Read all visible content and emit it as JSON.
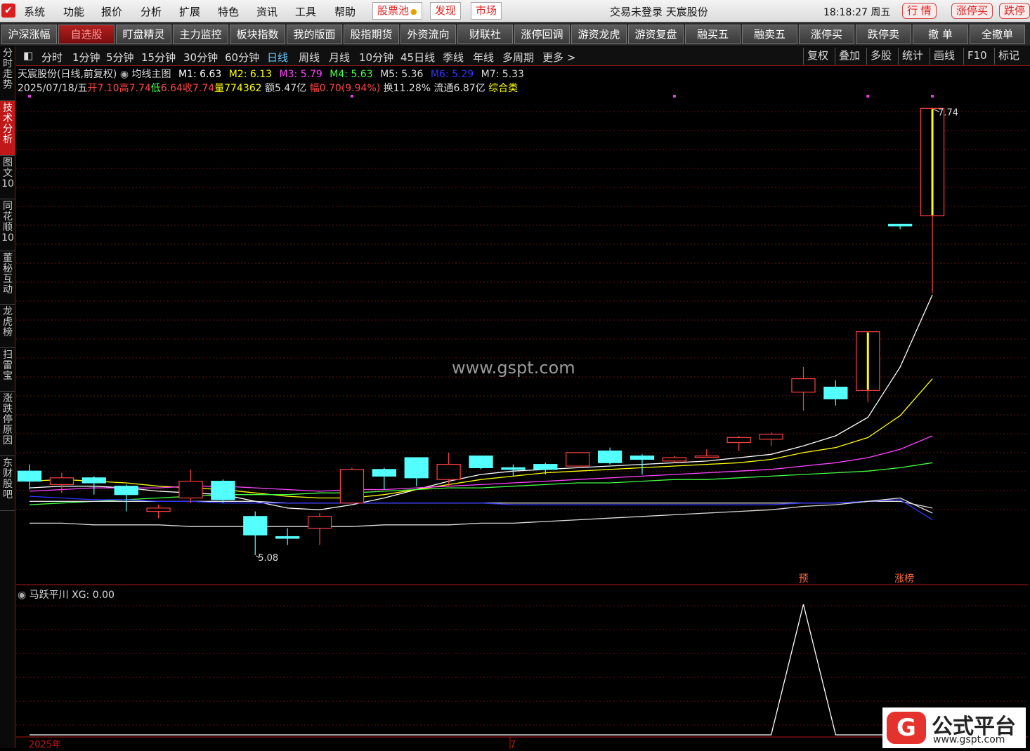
{
  "menubar": {
    "logo": "✔",
    "items": [
      "系统",
      "功能",
      "报价",
      "分析",
      "扩展",
      "特色",
      "资讯",
      "工具",
      "帮助"
    ],
    "red_items": [
      "股票池",
      "发现",
      "市场"
    ],
    "center_title": "交易未登录  天宸股份",
    "clock": "18:18:27 周五",
    "right_buttons": [
      "行  情",
      "涨停买",
      "跌停"
    ]
  },
  "toolbar": {
    "buttons": [
      "沪深涨幅",
      "自选股",
      "盯盘精灵",
      "主力监控",
      "板块指数",
      "我的版面",
      "股指期货",
      "外资流向",
      "财联社",
      "涨停回调",
      "游资龙虎",
      "游资复盘",
      "融买五",
      "融卖五",
      "涨停买",
      "跌停卖",
      "撤  单",
      "全撤单"
    ],
    "active": "自选股"
  },
  "side_tabs": [
    "分时走势",
    "技术分析",
    "图文10",
    "同花顺10",
    "董秘互动",
    "龙虎榜",
    "扫雷宝",
    "涨跌停原因",
    "东财股吧"
  ],
  "side_tab_active": "技术分析",
  "periods": [
    "分时",
    "1分钟",
    "5分钟",
    "15分钟",
    "30分钟",
    "60分钟",
    "日线",
    "周线",
    "月线",
    "10分钟",
    "45日线",
    "季线",
    "年线",
    "多周期",
    "更多 >"
  ],
  "period_active": "日线",
  "right_tools": [
    "复权",
    "叠加",
    "多股",
    "统计",
    "画线",
    "F10",
    "标记"
  ],
  "info": {
    "stock": "天宸股份(日线,前复权)",
    "indicator": "均线主图",
    "ma": [
      {
        "label": "M1: 6.63",
        "color": "#ffffff"
      },
      {
        "label": "M2: 6.13",
        "color": "#ffff00"
      },
      {
        "label": "M3: 5.79",
        "color": "#ff44ff"
      },
      {
        "label": "M4: 5.63",
        "color": "#44ff44"
      },
      {
        "label": "M5: 5.36",
        "color": "#dddddd"
      },
      {
        "label": "M6: 5.29",
        "color": "#3333ff"
      },
      {
        "label": "M7: 5.33",
        "color": "#dddddd"
      }
    ],
    "date": "2025/07/18/五",
    "open_label": "开",
    "open": "7.10",
    "high_label": "高",
    "high": "7.74",
    "low_label": "低",
    "low": "6.64",
    "close_label": "收",
    "close": "7.74",
    "vol_label": "量",
    "vol": "774362",
    "amount": "额5.47亿",
    "change_label": "幅",
    "change": "0.70(9.94%)",
    "turnover": "换11.28%",
    "float": "流通6.87亿",
    "category": "综合类"
  },
  "labels": {
    "high_mark": "7.74",
    "low_mark": "5.08",
    "pre_tag": "预",
    "limit_tag": "涨榜",
    "year": "2025年",
    "month": "7"
  },
  "indicator_panel": {
    "title": "马跃平川 XG: 0.00"
  },
  "watermark": "www.gspt.com",
  "brand": {
    "glyph": "G",
    "name": "公式平台",
    "url": "www.gspt.com"
  },
  "colors": {
    "up": "#ff4040",
    "down": "#54ffff",
    "limit": "#ffff00",
    "accent": "#c01818"
  },
  "chart_data": {
    "type": "candlestick",
    "candles": [
      {
        "o": 5.58,
        "h": 5.62,
        "l": 5.47,
        "c": 5.52
      },
      {
        "o": 5.5,
        "h": 5.57,
        "l": 5.45,
        "c": 5.54
      },
      {
        "o": 5.54,
        "h": 5.55,
        "l": 5.44,
        "c": 5.51
      },
      {
        "o": 5.49,
        "h": 5.5,
        "l": 5.34,
        "c": 5.44
      },
      {
        "o": 5.34,
        "h": 5.38,
        "l": 5.3,
        "c": 5.36
      },
      {
        "o": 5.42,
        "h": 5.59,
        "l": 5.39,
        "c": 5.52
      },
      {
        "o": 5.52,
        "h": 5.53,
        "l": 5.39,
        "c": 5.41
      },
      {
        "o": 5.31,
        "h": 5.34,
        "l": 5.08,
        "c": 5.2
      },
      {
        "o": 5.19,
        "h": 5.24,
        "l": 5.14,
        "c": 5.18
      },
      {
        "o": 5.24,
        "h": 5.33,
        "l": 5.14,
        "c": 5.31
      },
      {
        "o": 5.39,
        "h": 5.6,
        "l": 5.39,
        "c": 5.59
      },
      {
        "o": 5.59,
        "h": 5.6,
        "l": 5.47,
        "c": 5.55
      },
      {
        "o": 5.66,
        "h": 5.66,
        "l": 5.49,
        "c": 5.54
      },
      {
        "o": 5.53,
        "h": 5.69,
        "l": 5.49,
        "c": 5.62
      },
      {
        "o": 5.67,
        "h": 5.67,
        "l": 5.59,
        "c": 5.6
      },
      {
        "o": 5.6,
        "h": 5.62,
        "l": 5.55,
        "c": 5.59
      },
      {
        "o": 5.62,
        "h": 5.63,
        "l": 5.56,
        "c": 5.59
      },
      {
        "o": 5.61,
        "h": 5.69,
        "l": 5.61,
        "c": 5.69
      },
      {
        "o": 5.7,
        "h": 5.72,
        "l": 5.62,
        "c": 5.63
      },
      {
        "o": 5.67,
        "h": 5.68,
        "l": 5.56,
        "c": 5.65
      },
      {
        "o": 5.64,
        "h": 5.67,
        "l": 5.63,
        "c": 5.66
      },
      {
        "o": 5.67,
        "h": 5.71,
        "l": 5.66,
        "c": 5.67
      },
      {
        "o": 5.75,
        "h": 5.79,
        "l": 5.7,
        "c": 5.78
      },
      {
        "o": 5.77,
        "h": 5.81,
        "l": 5.73,
        "c": 5.8
      },
      {
        "o": 6.05,
        "h": 6.2,
        "l": 5.94,
        "c": 6.13
      },
      {
        "o": 6.08,
        "h": 6.12,
        "l": 5.97,
        "c": 6.01
      },
      {
        "o": 6.06,
        "h": 6.41,
        "l": 5.99,
        "c": 6.41
      },
      {
        "o": 7.05,
        "h": 7.05,
        "l": 7.02,
        "c": 7.04
      },
      {
        "o": 7.1,
        "h": 7.74,
        "l": 6.64,
        "c": 7.74
      }
    ],
    "ma_lines": [
      {
        "name": "M1",
        "color": "#ffffff",
        "values": [
          5.48,
          5.49,
          5.49,
          5.48,
          5.46,
          5.45,
          5.44,
          5.4,
          5.36,
          5.35,
          5.38,
          5.42,
          5.47,
          5.52,
          5.56,
          5.58,
          5.59,
          5.6,
          5.61,
          5.62,
          5.63,
          5.64,
          5.66,
          5.68,
          5.73,
          5.79,
          5.9,
          6.2,
          6.63
        ]
      },
      {
        "name": "M2",
        "color": "#ffff00",
        "values": [
          5.52,
          5.53,
          5.52,
          5.51,
          5.49,
          5.48,
          5.47,
          5.45,
          5.43,
          5.42,
          5.42,
          5.44,
          5.47,
          5.5,
          5.53,
          5.55,
          5.57,
          5.58,
          5.59,
          5.6,
          5.61,
          5.62,
          5.63,
          5.65,
          5.69,
          5.72,
          5.78,
          5.91,
          6.13
        ]
      },
      {
        "name": "M3",
        "color": "#ff44ff",
        "values": [
          5.46,
          5.47,
          5.48,
          5.48,
          5.48,
          5.49,
          5.49,
          5.48,
          5.47,
          5.46,
          5.47,
          5.47,
          5.48,
          5.49,
          5.5,
          5.51,
          5.52,
          5.53,
          5.54,
          5.55,
          5.56,
          5.57,
          5.58,
          5.59,
          5.61,
          5.63,
          5.66,
          5.71,
          5.79
        ]
      },
      {
        "name": "M4",
        "color": "#44ff44",
        "values": [
          5.38,
          5.39,
          5.4,
          5.41,
          5.42,
          5.43,
          5.44,
          5.44,
          5.44,
          5.45,
          5.45,
          5.46,
          5.47,
          5.48,
          5.48,
          5.49,
          5.5,
          5.51,
          5.51,
          5.52,
          5.53,
          5.53,
          5.54,
          5.55,
          5.56,
          5.57,
          5.58,
          5.6,
          5.63
        ]
      },
      {
        "name": "M5",
        "color": "#dddddd",
        "values": [
          5.4,
          5.4,
          5.4,
          5.4,
          5.4,
          5.4,
          5.4,
          5.4,
          5.39,
          5.39,
          5.39,
          5.39,
          5.39,
          5.39,
          5.39,
          5.39,
          5.39,
          5.39,
          5.39,
          5.39,
          5.39,
          5.39,
          5.39,
          5.39,
          5.39,
          5.39,
          5.4,
          5.4,
          5.36
        ]
      },
      {
        "name": "M6",
        "color": "#3333ff",
        "values": [
          5.43,
          5.42,
          5.41,
          5.41,
          5.4,
          5.4,
          5.39,
          5.39,
          5.39,
          5.39,
          5.39,
          5.39,
          5.39,
          5.39,
          5.39,
          5.38,
          5.38,
          5.38,
          5.38,
          5.38,
          5.38,
          5.38,
          5.38,
          5.38,
          5.39,
          5.39,
          5.4,
          5.41,
          5.29
        ]
      },
      {
        "name": "M7",
        "color": "#dddddd",
        "values": [
          5.27,
          5.27,
          5.26,
          5.26,
          5.26,
          5.25,
          5.25,
          5.25,
          5.25,
          5.25,
          5.25,
          5.26,
          5.26,
          5.26,
          5.27,
          5.27,
          5.28,
          5.29,
          5.3,
          5.31,
          5.32,
          5.33,
          5.34,
          5.35,
          5.37,
          5.38,
          5.4,
          5.42,
          5.33
        ]
      }
    ],
    "indicator": {
      "name": "马跃平川",
      "values": [
        0,
        0,
        0,
        0,
        0,
        0,
        0,
        0,
        0,
        0,
        0,
        0,
        0,
        0,
        0,
        0,
        0,
        0,
        0,
        0,
        0,
        0,
        0,
        0,
        1,
        0,
        0,
        0,
        0
      ]
    },
    "ylim": [
      5.0,
      7.8
    ],
    "markers_top": [
      0,
      10,
      20,
      26,
      28
    ]
  }
}
